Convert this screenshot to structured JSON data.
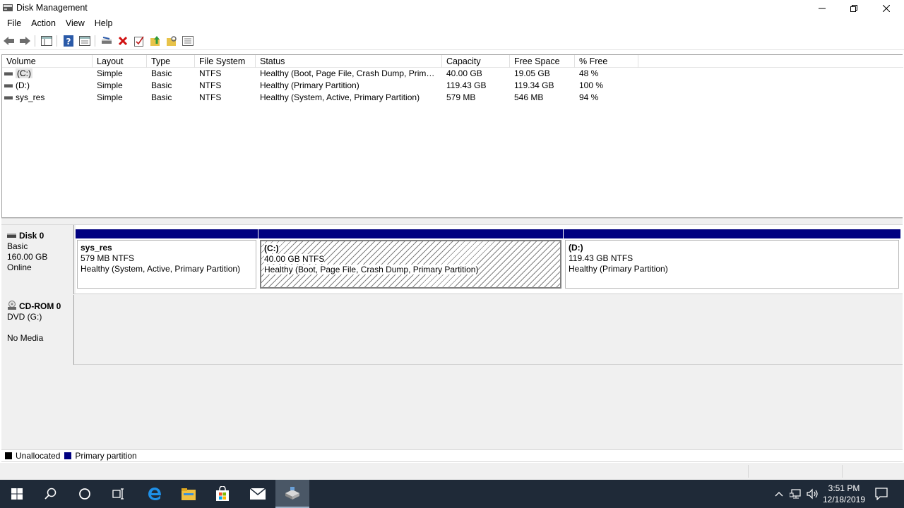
{
  "window": {
    "title": "Disk Management"
  },
  "menu": {
    "items": [
      "File",
      "Action",
      "View",
      "Help"
    ]
  },
  "toolbar": {
    "buttons": [
      "back-icon",
      "forward-icon",
      "show-hide-console-tree-icon",
      "help-icon",
      "properties-icon",
      "connect-drive-icon",
      "delete-icon",
      "check-icon",
      "up-folder-icon",
      "folder-options-icon",
      "list-view-icon"
    ]
  },
  "volume_list": {
    "columns": [
      "Volume",
      "Layout",
      "Type",
      "File System",
      "Status",
      "Capacity",
      "Free Space",
      "% Free"
    ],
    "rows": [
      {
        "volume": "(C:)",
        "layout": "Simple",
        "type": "Basic",
        "fs": "NTFS",
        "status": "Healthy (Boot, Page File, Crash Dump, Primar...",
        "capacity": "40.00 GB",
        "free": "19.05 GB",
        "pct": "48 %"
      },
      {
        "volume": "(D:)",
        "layout": "Simple",
        "type": "Basic",
        "fs": "NTFS",
        "status": "Healthy (Primary Partition)",
        "capacity": "119.43 GB",
        "free": "119.34 GB",
        "pct": "100 %"
      },
      {
        "volume": "sys_res",
        "layout": "Simple",
        "type": "Basic",
        "fs": "NTFS",
        "status": "Healthy (System, Active, Primary Partition)",
        "capacity": "579 MB",
        "free": "546 MB",
        "pct": "94 %"
      }
    ]
  },
  "disks": {
    "disk0": {
      "name": "Disk 0",
      "type": "Basic",
      "size": "160.00 GB",
      "state": "Online",
      "partitions": [
        {
          "name": "sys_res",
          "size": "579 MB NTFS",
          "status": "Healthy (System, Active, Primary Partition)"
        },
        {
          "name": "(C:)",
          "size": "40.00 GB NTFS",
          "status": "Healthy (Boot, Page File, Crash Dump, Primary Partition)"
        },
        {
          "name": "(D:)",
          "size": "119.43 GB NTFS",
          "status": "Healthy (Primary Partition)"
        }
      ]
    },
    "cdrom0": {
      "name": "CD-ROM 0",
      "type": "DVD (G:)",
      "state": "No Media"
    }
  },
  "legend": {
    "unallocated": "Unallocated",
    "primary": "Primary partition",
    "unallocated_color": "#000000",
    "primary_color": "#000080"
  },
  "taskbar": {
    "time": "3:51 PM",
    "date": "12/18/2019"
  }
}
